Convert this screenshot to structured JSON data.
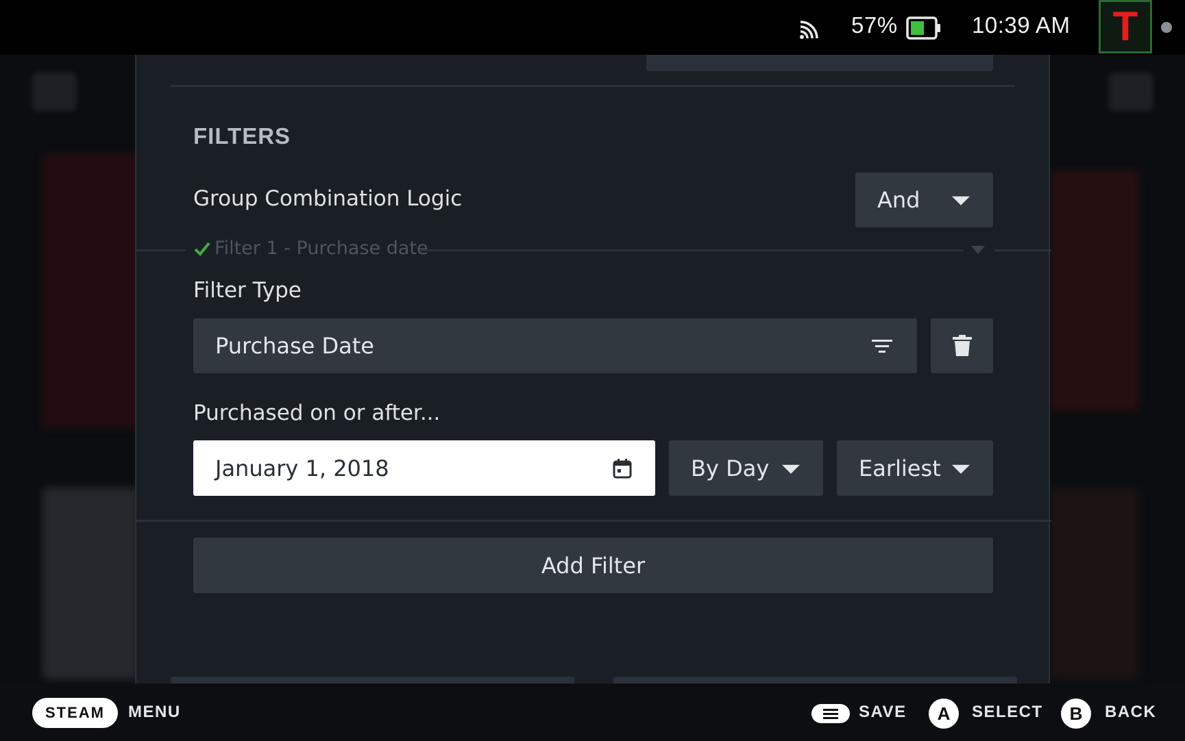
{
  "status_bar": {
    "battery_percent": "57%",
    "time": "10:39 AM",
    "avatar_letter": "T",
    "icons": [
      "cast-icon",
      "battery-icon",
      "avatar",
      "notification-dot"
    ]
  },
  "filters": {
    "section_title": "FILTERS",
    "group_logic": {
      "label": "Group Combination Logic",
      "value": "And"
    },
    "filter_1": {
      "header": "Filter 1 - Purchase date",
      "type_label": "Filter Type",
      "type_value": "Purchase Date",
      "purchased_label": "Purchased on or after...",
      "date_value": "January 1, 2018",
      "granularity": "By Day",
      "order": "Earliest"
    },
    "add_filter_label": "Add Filter"
  },
  "footer": {
    "steam_label": "STEAM",
    "menu_label": "MENU",
    "save_label": "SAVE",
    "a_glyph": "A",
    "select_label": "SELECT",
    "b_glyph": "B",
    "back_label": "BACK"
  },
  "colors": {
    "panel_bg": "#1a1f26",
    "control_bg": "#323840",
    "check_green": "#3fae3f",
    "avatar_red": "#e51d1d",
    "battery_green": "#3fbf3f"
  }
}
